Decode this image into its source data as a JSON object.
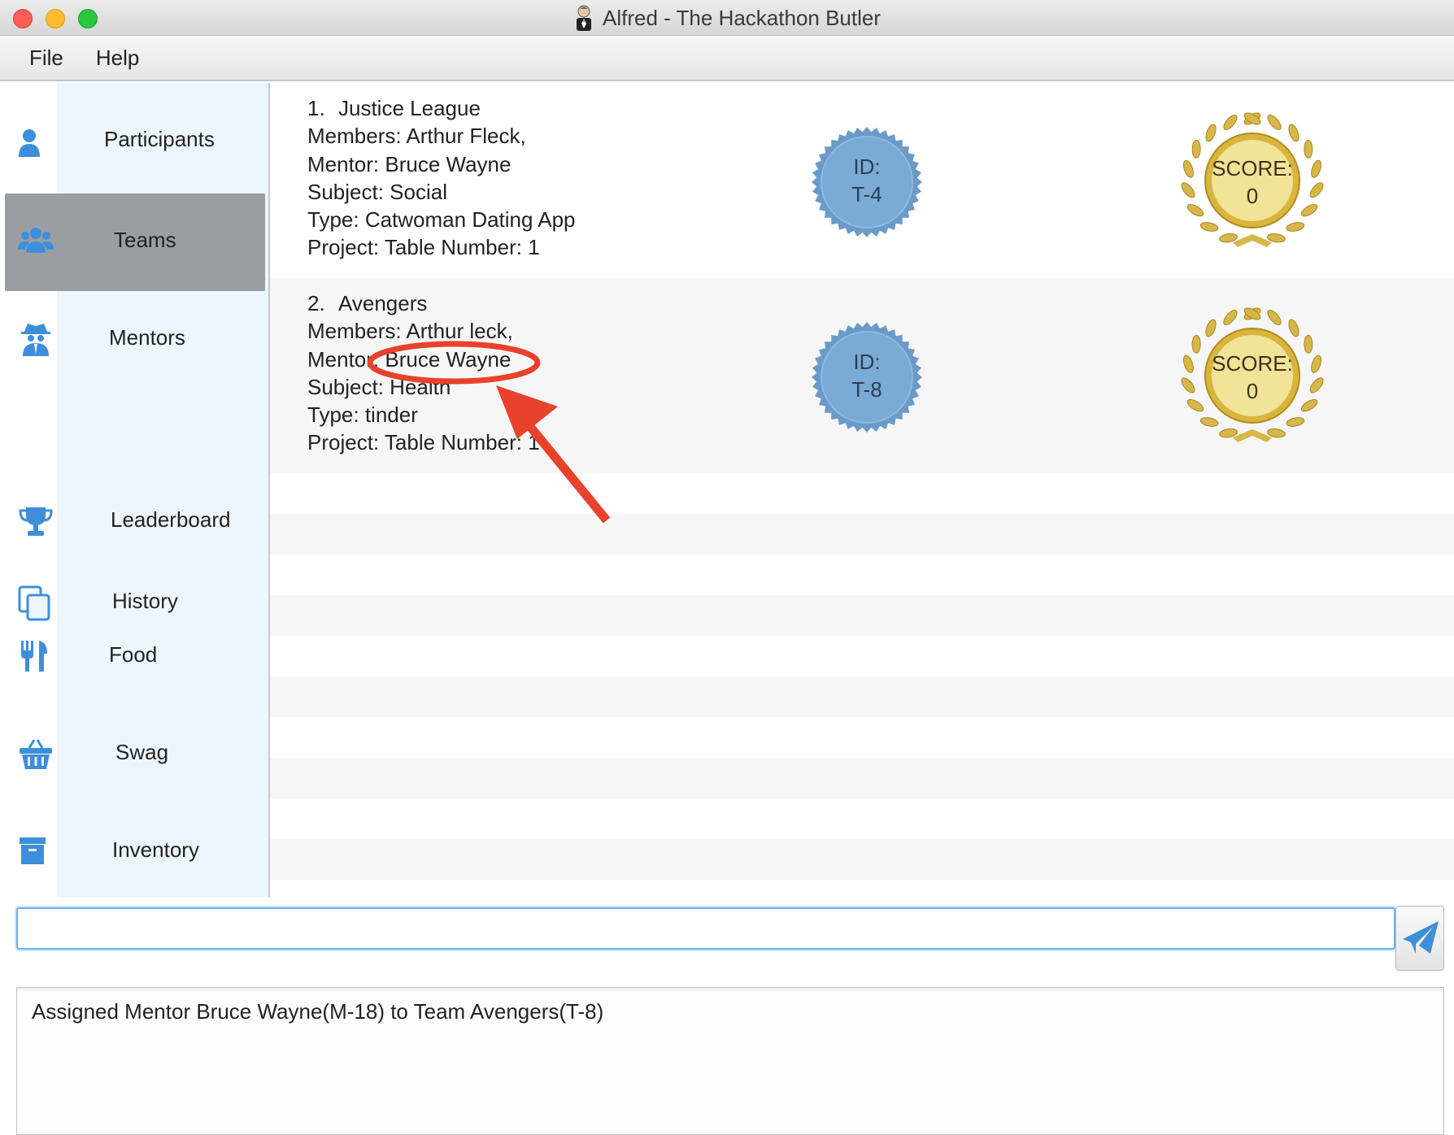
{
  "window": {
    "title": "Alfred - The Hackathon Butler",
    "icon": "butler-icon"
  },
  "menu": [
    "File",
    "Help"
  ],
  "sidebar": {
    "items": [
      {
        "label": "Participants",
        "icon": "person-icon",
        "active": false
      },
      {
        "label": "Teams",
        "icon": "group-icon",
        "active": true
      },
      {
        "label": "Mentors",
        "icon": "spy-icon",
        "active": false
      },
      {
        "label": "Leaderboard",
        "icon": "trophy-icon",
        "active": false
      },
      {
        "label": "History",
        "icon": "copy-icon",
        "active": false
      },
      {
        "label": "Food",
        "icon": "utensils-icon",
        "active": false
      },
      {
        "label": "Swag",
        "icon": "basket-icon",
        "active": false
      },
      {
        "label": "Inventory",
        "icon": "archive-icon",
        "active": false
      }
    ]
  },
  "teams": [
    {
      "index": "1.",
      "name": "Justice League",
      "members": "Members: Arthur Fleck,",
      "mentor": "Mentor: Bruce Wayne",
      "subject": "Subject: Social",
      "type": "Type: Catwoman Dating App",
      "project": "Project:  Table Number: 1",
      "id_label": "ID:",
      "id": "T-4",
      "score_label": "SCORE:",
      "score": "0"
    },
    {
      "index": "2.",
      "name": "Avengers",
      "members": "Members: Arthur leck,",
      "mentor": "Mentor: Bruce Wayne",
      "subject": "Subject: Health",
      "type": "Type: tinder",
      "project": "Project:  Table Number: 1",
      "id_label": "ID:",
      "id": "T-8",
      "score_label": "SCORE:",
      "score": "0"
    }
  ],
  "command": {
    "value": "",
    "placeholder": ""
  },
  "result": {
    "text": "Assigned Mentor Bruce Wayne(M-18) to Team Avengers(T-8)"
  },
  "colors": {
    "accent": "#3d8fdb",
    "sidebar_band": "#eef6fd",
    "active_item": "#9b9ea1",
    "id_badge": "#7aaad6",
    "annotation": "#e8412c"
  }
}
